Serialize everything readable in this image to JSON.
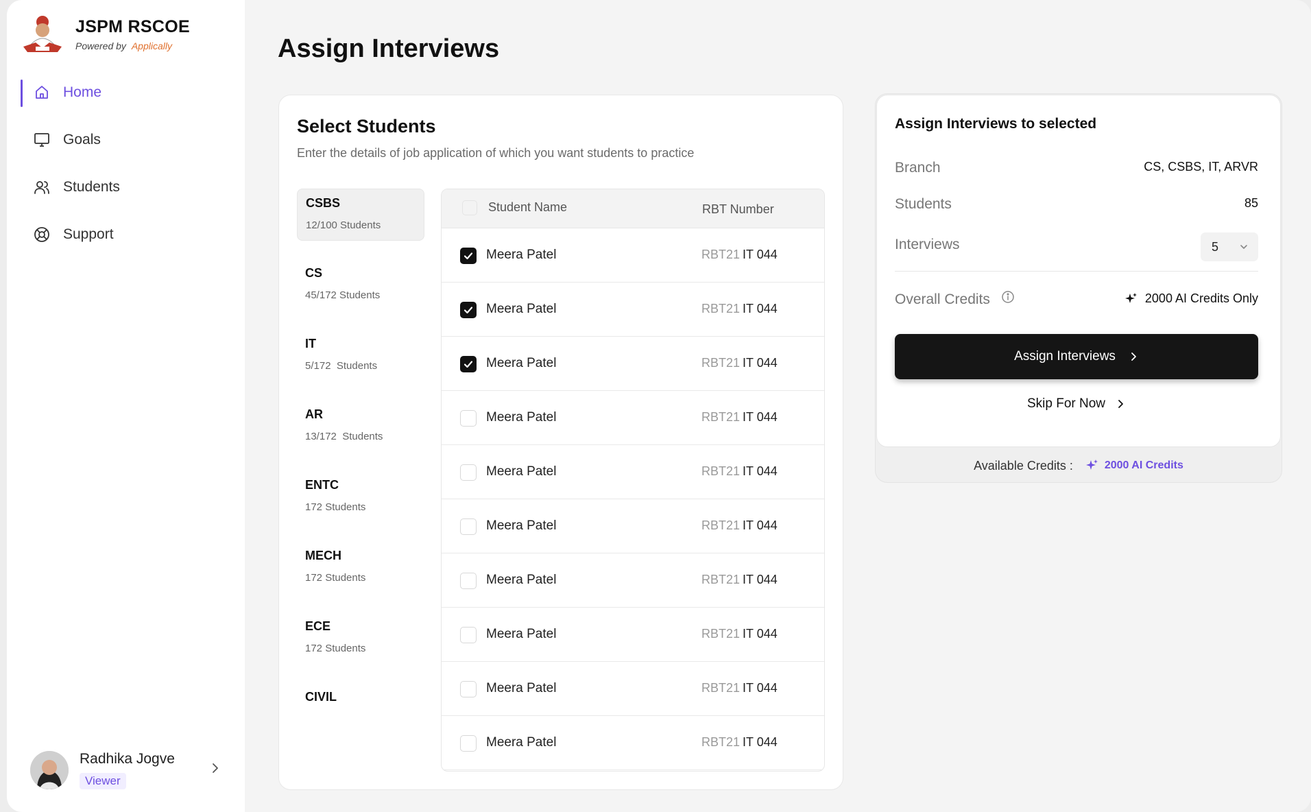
{
  "brand": {
    "name": "JSPM RSCOE",
    "powered_prefix": "Powered by",
    "powered_name": "Applically",
    "accent_color": "#e0702d"
  },
  "nav": [
    {
      "label": "Home",
      "icon": "home-icon",
      "active": true
    },
    {
      "label": "Goals",
      "icon": "monitor-icon",
      "active": false
    },
    {
      "label": "Students",
      "icon": "users-icon",
      "active": false
    },
    {
      "label": "Support",
      "icon": "lifebuoy-icon",
      "active": false
    }
  ],
  "user": {
    "name": "Radhika Jogve",
    "role": "Viewer"
  },
  "page": {
    "title": "Assign Interviews"
  },
  "select": {
    "title": "Select Students",
    "description": "Enter the details of job application of which you want students to practice"
  },
  "branches": [
    {
      "name": "CSBS",
      "count": "12/100 Students",
      "active": true
    },
    {
      "name": "CS",
      "count": "45/172 Students",
      "active": false
    },
    {
      "name": "IT",
      "count": "5/172  Students",
      "active": false
    },
    {
      "name": "AR",
      "count": "13/172  Students",
      "active": false
    },
    {
      "name": "ENTC",
      "count": "172 Students",
      "active": false
    },
    {
      "name": "MECH",
      "count": "172 Students",
      "active": false
    },
    {
      "name": "ECE",
      "count": "172 Students",
      "active": false
    },
    {
      "name": "CIVIL",
      "count": "",
      "active": false
    }
  ],
  "table": {
    "headers": {
      "name": "Student Name",
      "rbt": "RBT Number"
    },
    "rows": [
      {
        "name": "Meera Patel",
        "rbt_prefix": "RBT21",
        "rbt_suffix": "IT 044",
        "checked": true
      },
      {
        "name": "Meera Patel",
        "rbt_prefix": "RBT21",
        "rbt_suffix": "IT 044",
        "checked": true
      },
      {
        "name": "Meera Patel",
        "rbt_prefix": "RBT21",
        "rbt_suffix": "IT 044",
        "checked": true
      },
      {
        "name": "Meera Patel",
        "rbt_prefix": "RBT21",
        "rbt_suffix": "IT 044",
        "checked": false
      },
      {
        "name": "Meera Patel",
        "rbt_prefix": "RBT21",
        "rbt_suffix": "IT 044",
        "checked": false
      },
      {
        "name": "Meera Patel",
        "rbt_prefix": "RBT21",
        "rbt_suffix": "IT 044",
        "checked": false
      },
      {
        "name": "Meera Patel",
        "rbt_prefix": "RBT21",
        "rbt_suffix": "IT 044",
        "checked": false
      },
      {
        "name": "Meera Patel",
        "rbt_prefix": "RBT21",
        "rbt_suffix": "IT 044",
        "checked": false
      },
      {
        "name": "Meera Patel",
        "rbt_prefix": "RBT21",
        "rbt_suffix": "IT 044",
        "checked": false
      },
      {
        "name": "Meera Patel",
        "rbt_prefix": "RBT21",
        "rbt_suffix": "IT 044",
        "checked": false
      }
    ]
  },
  "assign": {
    "title": "Assign Interviews to selected",
    "branch_label": "Branch",
    "branch_value": "CS, CSBS, IT, ARVR",
    "students_label": "Students",
    "students_value": "85",
    "interviews_label": "Interviews",
    "interviews_value": "5",
    "credits_label": "Overall Credits",
    "credits_value": "2000 AI Credits Only",
    "assign_button": "Assign Interviews",
    "skip_button": "Skip For Now",
    "available_label": "Available Credits :",
    "available_value": "2000 AI Credits"
  },
  "colors": {
    "accent": "#6d4fe0",
    "primary_button": "#151515"
  }
}
